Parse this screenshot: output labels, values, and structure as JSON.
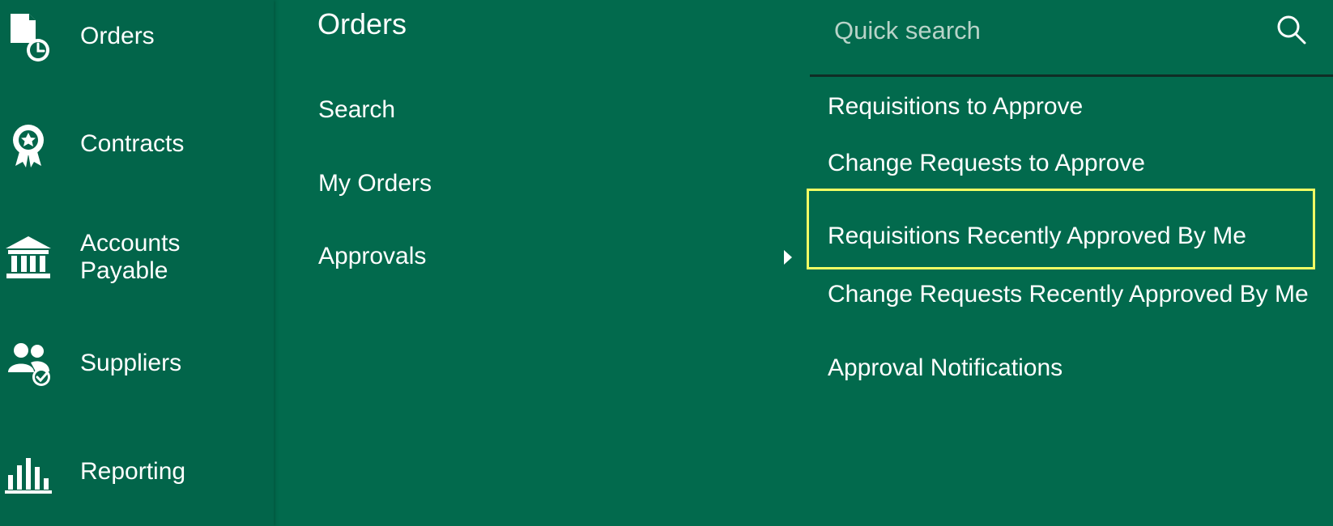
{
  "sidebar": {
    "items": [
      {
        "label": "Orders",
        "icon": "orders-clock-icon"
      },
      {
        "label": "Contracts",
        "icon": "award-ribbon-icon"
      },
      {
        "label": "Accounts\nPayable",
        "icon": "bank-building-icon"
      },
      {
        "label": "Suppliers",
        "icon": "users-check-icon"
      },
      {
        "label": "Reporting",
        "icon": "bar-chart-icon"
      }
    ]
  },
  "orders_panel": {
    "title": "Orders",
    "items": [
      {
        "label": "Search"
      },
      {
        "label": "My Orders"
      },
      {
        "label": "Approvals"
      }
    ]
  },
  "quick_search": {
    "placeholder": "Quick search",
    "value": ""
  },
  "approvals_menu": {
    "items": [
      {
        "label": "Requisitions to Approve"
      },
      {
        "label": "Change Requests to Approve"
      },
      {
        "label": "Requisitions Recently Approved By Me",
        "highlighted": true
      },
      {
        "label": "Change Requests Recently Approved By Me"
      },
      {
        "label": "Approval Notifications"
      }
    ]
  },
  "colors": {
    "background": "#026a4d",
    "sidebar": "#02654a",
    "text": "#ffffff",
    "placeholder": "#b8d3c8",
    "highlight": "#f1ff64"
  }
}
